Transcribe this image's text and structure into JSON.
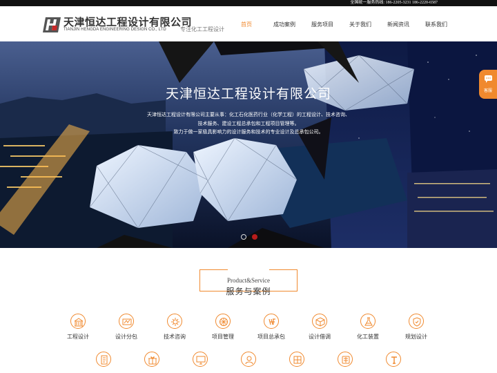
{
  "topbar": {
    "hotline": "全国统一服务热线: 186-2205-3231 186-2220-6587"
  },
  "brand": {
    "name_cn": "天津恒达工程设计有限公司",
    "name_en": "TIANJIN HENGDA ENGINEERING DESIGN CO., LTD",
    "slogan": "专注化工工程设计",
    "accent": "#f0892e",
    "logo_red": "#c62828"
  },
  "nav": [
    {
      "label": "首页",
      "active": true
    },
    {
      "label": "成功案例"
    },
    {
      "label": "服务项目"
    },
    {
      "label": "关于我们"
    },
    {
      "label": "新闻资讯"
    },
    {
      "label": "联系我们"
    }
  ],
  "hero": {
    "title": "天津恒达工程设计有限公司",
    "line1": "天津恒达工程设计有限公司主要从事：化工石化医药行业（化学工程）的工程设计、技术咨询、",
    "line2": "技术服务、建设工程总承包和工程项目管理等。",
    "line3": "致力于做一家极具影响力的设计服务和技术的专业设计及总承包公司。"
  },
  "kefu": {
    "label": "客服",
    "icon": "chat-icon"
  },
  "section": {
    "en": "Product&Service",
    "cn": "服务与案例"
  },
  "services_row1": [
    {
      "label": "工程设计",
      "icon": "building-icon"
    },
    {
      "label": "设计分包",
      "icon": "blueprint-icon"
    },
    {
      "label": "技术咨询",
      "icon": "gear-icon"
    },
    {
      "label": "项目管理",
      "icon": "pinwheel-icon"
    },
    {
      "label": "项目总承包",
      "icon": "contract-icon"
    },
    {
      "label": "设计借调",
      "icon": "box-icon"
    },
    {
      "label": "化工装置",
      "icon": "lab-icon"
    },
    {
      "label": "规划设计",
      "icon": "shield-icon"
    }
  ],
  "services_row2_icons": [
    {
      "icon": "document-icon"
    },
    {
      "icon": "gift-icon"
    },
    {
      "icon": "monitor-icon"
    },
    {
      "icon": "person-icon"
    },
    {
      "icon": "grid-icon"
    },
    {
      "icon": "stamp-icon"
    },
    {
      "icon": "text-icon"
    }
  ]
}
